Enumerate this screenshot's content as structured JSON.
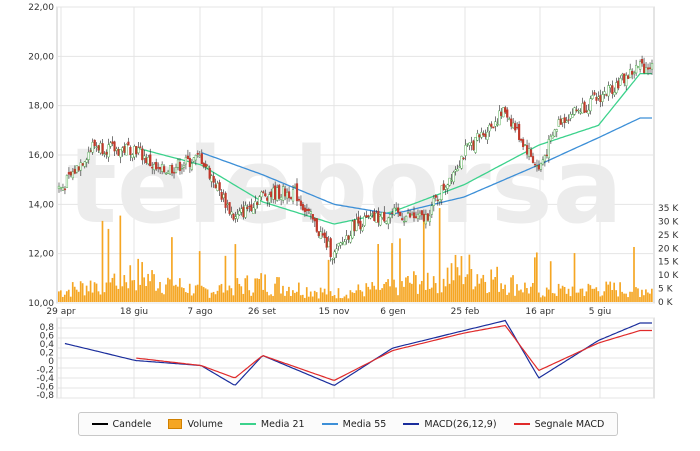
{
  "chart_data": [
    {
      "type": "candlestick",
      "title": "",
      "xlabel": "",
      "ylabel": "",
      "ylim": [
        10,
        22
      ],
      "y_ticks": [
        "22,00",
        "20,00",
        "18,00",
        "16,00",
        "14,00",
        "12,00",
        "10,00"
      ],
      "x_tick_labels": [
        "29 apr",
        "18 giu",
        "7 ago",
        "26 set",
        "15 nov",
        "6 gen",
        "25 feb",
        "16 apr",
        "5 giu"
      ],
      "grid": true,
      "watermark": "teleborsa",
      "series": [
        {
          "name": "Candele",
          "color": "#000000",
          "close_profile": [
            {
              "date": "29 apr",
              "value": 14.7
            },
            {
              "date": "mid may",
              "value": 16.4
            },
            {
              "date": "end may",
              "value": 16.2
            },
            {
              "date": "18 giu",
              "value": 16.3
            },
            {
              "date": "early jul",
              "value": 15.3
            },
            {
              "date": "7 ago",
              "value": 15.9
            },
            {
              "date": "mid sep",
              "value": 13.4
            },
            {
              "date": "26 set",
              "value": 14.4
            },
            {
              "date": "mid oct",
              "value": 14.5
            },
            {
              "date": "15 nov",
              "value": 11.9
            },
            {
              "date": "early dec",
              "value": 13.2
            },
            {
              "date": "6 gen",
              "value": 13.6
            },
            {
              "date": "end jan",
              "value": 13.4
            },
            {
              "date": "25 feb",
              "value": 16.1
            },
            {
              "date": "mid mar",
              "value": 17.8
            },
            {
              "date": "16 apr",
              "value": 15.4
            },
            {
              "date": "early may",
              "value": 17.4
            },
            {
              "date": "5 giu",
              "value": 18.3
            },
            {
              "date": "end jun",
              "value": 19.6
            }
          ]
        },
        {
          "name": "Media 21",
          "color": "#3cd28c",
          "values_profile": [
            {
              "date": "18 giu",
              "value": 16.3
            },
            {
              "date": "7 ago",
              "value": 15.6
            },
            {
              "date": "26 set",
              "value": 14.1
            },
            {
              "date": "15 nov",
              "value": 13.2
            },
            {
              "date": "6 gen",
              "value": 13.7
            },
            {
              "date": "25 feb",
              "value": 14.8
            },
            {
              "date": "16 apr",
              "value": 16.4
            },
            {
              "date": "5 giu",
              "value": 17.2
            },
            {
              "date": "end jun",
              "value": 19.3
            }
          ]
        },
        {
          "name": "Media 55",
          "color": "#3c8fd7",
          "values_profile": [
            {
              "date": "7 ago",
              "value": 16.1
            },
            {
              "date": "26 set",
              "value": 15.2
            },
            {
              "date": "15 nov",
              "value": 14.0
            },
            {
              "date": "6 gen",
              "value": 13.6
            },
            {
              "date": "25 feb",
              "value": 14.3
            },
            {
              "date": "16 apr",
              "value": 15.6
            },
            {
              "date": "5 giu",
              "value": 16.7
            },
            {
              "date": "end jun",
              "value": 17.5
            }
          ]
        }
      ]
    },
    {
      "type": "bar",
      "title": "",
      "ylabel": "",
      "ylim": [
        0,
        35000
      ],
      "y_ticks": [
        "35 K",
        "30 K",
        "25 K",
        "20 K",
        "15 K",
        "10 K",
        "5 K",
        "0 K"
      ],
      "series": [
        {
          "name": "Volume",
          "color": "#f5a623",
          "volume_profile_k": [
            {
              "date": "29 apr",
              "value": 5
            },
            {
              "date": "18 giu",
              "value": 13
            },
            {
              "date": "7 ago",
              "value": 5
            },
            {
              "date": "26 set",
              "value": 9
            },
            {
              "date": "15 nov",
              "value": 4
            },
            {
              "date": "6 gen",
              "value": 7
            },
            {
              "date": "25 feb",
              "value": 15
            },
            {
              "date": "16 apr",
              "value": 5
            },
            {
              "date": "5 giu",
              "value": 6
            }
          ]
        }
      ]
    },
    {
      "type": "line",
      "title": "",
      "ylabel": "",
      "ylim": [
        -0.8,
        0.8
      ],
      "y_ticks": [
        "0,8",
        "0,6",
        "0,4",
        "0,2",
        "0",
        "-0,2",
        "-0,4",
        "-0,6",
        "-0,8"
      ],
      "series": [
        {
          "name": "MACD(26,12,9)",
          "color": "#1a2d9c",
          "values_profile": [
            {
              "date": "29 apr",
              "value": 0.3
            },
            {
              "date": "18 giu",
              "value": -0.05
            },
            {
              "date": "7 ago",
              "value": -0.15
            },
            {
              "date": "mid sep",
              "value": -0.55
            },
            {
              "date": "26 set",
              "value": 0.05
            },
            {
              "date": "15 nov",
              "value": -0.55
            },
            {
              "date": "6 gen",
              "value": 0.2
            },
            {
              "date": "25 feb",
              "value": 0.55
            },
            {
              "date": "mid mar",
              "value": 0.75
            },
            {
              "date": "16 apr",
              "value": -0.4
            },
            {
              "date": "5 giu",
              "value": 0.35
            },
            {
              "date": "end jun",
              "value": 0.7
            }
          ]
        },
        {
          "name": "Segnale MACD",
          "color": "#e02a2a",
          "values_profile": [
            {
              "date": "18 giu",
              "value": 0.0
            },
            {
              "date": "7 ago",
              "value": -0.15
            },
            {
              "date": "mid sep",
              "value": -0.4
            },
            {
              "date": "26 set",
              "value": 0.05
            },
            {
              "date": "15 nov",
              "value": -0.45
            },
            {
              "date": "6 gen",
              "value": 0.15
            },
            {
              "date": "25 feb",
              "value": 0.5
            },
            {
              "date": "mid mar",
              "value": 0.65
            },
            {
              "date": "16 apr",
              "value": -0.25
            },
            {
              "date": "5 giu",
              "value": 0.3
            },
            {
              "date": "end jun",
              "value": 0.55
            }
          ]
        }
      ]
    }
  ],
  "legend": [
    {
      "key": "candle",
      "label": "Candele",
      "color": "#000000"
    },
    {
      "key": "volume",
      "label": "Volume",
      "color": "#f5a623"
    },
    {
      "key": "ma21",
      "label": "Media 21",
      "color": "#3cd28c"
    },
    {
      "key": "ma55",
      "label": "Media 55",
      "color": "#3c8fd7"
    },
    {
      "key": "macd",
      "label": "MACD(26,12,9)",
      "color": "#1a2d9c"
    },
    {
      "key": "signal",
      "label": "Segnale MACD",
      "color": "#e02a2a"
    }
  ],
  "colors": {
    "candle_up": "#2e9a2e",
    "candle_down": "#c0392b",
    "grid": "#e4e4e4"
  }
}
